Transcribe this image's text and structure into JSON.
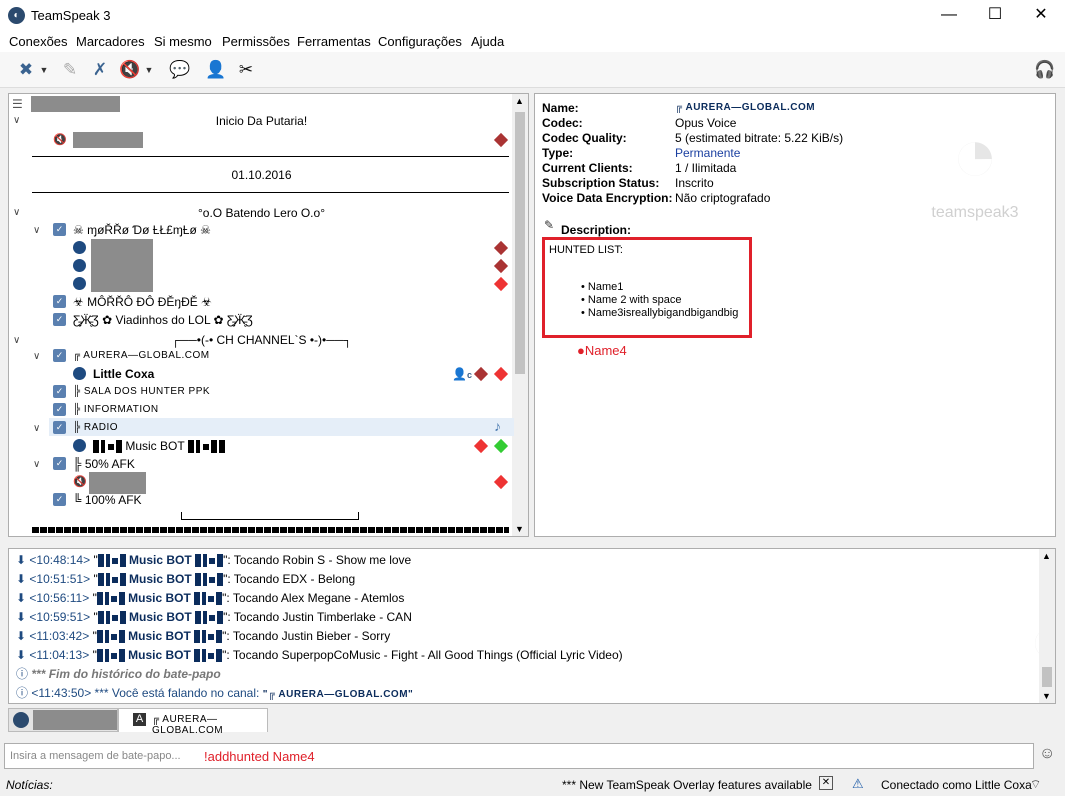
{
  "window": {
    "title": "TeamSpeak 3",
    "minimize": "—",
    "maximize": "☐",
    "close": "✕"
  },
  "menu": [
    "Conexões",
    "Marcadores",
    "Si mesmo",
    "Permissões",
    "Ferramentas",
    "Configurações",
    "Ajuda"
  ],
  "tree": {
    "ch_inicio": "Inicio Da Putaria!",
    "ch_date": "01.10.2016",
    "ch_batendo": "°o.O Batendo Lero O.o°",
    "ch_morro": "☠ ɱøŘŘø Ɗø ȽŁ£ɱȽø ☠",
    "ch_morro2": "☣ MÔŘŘÔ ĐÔ ĐĚŋĐĚ ☣",
    "ch_viadinhos": "Ƹ̵̡Ӝ̵̨̄Ʒ ✿ Viadinhos do LOL ✿  Ƹ̵̡Ӝ̵̨̄Ʒ",
    "ch_channels": "┌──•(-• CH CHANNEL`S •-)•──┐",
    "ch_aurera": "╔ AURERA—GLOBAL.COM",
    "user_little": "Little Coxa",
    "ch_sala": "╠ SALA DOS HUNTER PPK",
    "ch_information": "╠ INFORMATION",
    "ch_radio": "╠ RADIO",
    "music_bot": "Music BOT",
    "ch_50": "╠ 50% AFK",
    "ch_100": "╚ 100% AFK",
    "badge_c": "c"
  },
  "info": {
    "labels": [
      "Name:",
      "Codec:",
      "Codec Quality:",
      "Type:",
      "Current Clients:",
      "Subscription Status:",
      "Voice Data Encryption:"
    ],
    "values": [
      "╔ AURERA—GLOBAL.COM",
      "Opus Voice",
      "5 (estimated bitrate: 5.22 KiB/s)",
      "Permanente",
      "1 / Ilimitada",
      "Inscrito",
      "Não criptografado"
    ],
    "desc_label": "Description:",
    "hunted_title": "HUNTED LIST:",
    "hunted": [
      "Name1",
      "Name 2 with space",
      "Name3isreallybigandbigandbig"
    ],
    "annotation": "Name4",
    "logo_text": "teamspeak3"
  },
  "chat": {
    "rows": [
      {
        "time": "<10:48:14>",
        "song": "Tocando Robin S - Show me love"
      },
      {
        "time": "<10:51:51>",
        "song": "Tocando EDX - Belong"
      },
      {
        "time": "<10:56:11>",
        "song": "Tocando Alex Megane - Atemlos"
      },
      {
        "time": "<10:59:51>",
        "song": "Tocando Justin Timberlake - CAN"
      },
      {
        "time": "<11:03:42>",
        "song": "Tocando Justin Bieber - Sorry"
      },
      {
        "time": "<11:04:13>",
        "song": "Tocando SuperpopCoMusic - Fight - All Good Things (Official Lyric Video)"
      }
    ],
    "bot": "Music BOT",
    "end_history": "*** Fim do histórico do bate-papo",
    "last_time": "<11:43:50>",
    "last_text": "*** Você está falando no canal:",
    "last_channel": "\"╔ AURERA—GLOBAL.COM\""
  },
  "tabs": {
    "channel": "╔ AURERA—GLOBAL.COM"
  },
  "input": {
    "placeholder": "Insira a mensagem de bate-papo...",
    "annotation": "!addhunted Name4"
  },
  "status": {
    "news_label": "Notícias:",
    "news": "*** New TeamSpeak Overlay features available. Pre",
    "connected": "Conectado como Little Coxa"
  },
  "colors": {
    "accent": "#1e4a80",
    "annotation": "#e0202a",
    "link": "#1a3fa0"
  }
}
